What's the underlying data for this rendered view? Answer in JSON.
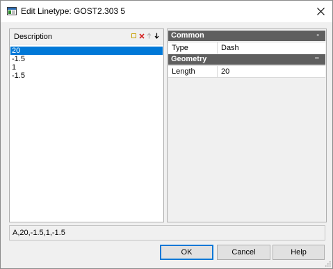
{
  "window": {
    "title": "Edit Linetype: GOST2.303 5"
  },
  "description_panel": {
    "header_label": "Description",
    "toolbar": [
      "add-icon",
      "delete-icon",
      "move-up-icon",
      "move-down-icon"
    ],
    "items": [
      "20",
      "-1.5",
      "1",
      "-1.5"
    ],
    "selected_index": 0
  },
  "properties": {
    "common": {
      "label": "Common",
      "toggle": "-",
      "type_name": "Type",
      "type_value": "Dash"
    },
    "geometry": {
      "label": "Geometry",
      "toggle": "−",
      "length_name": "Length",
      "length_value": "20"
    }
  },
  "status": {
    "definition": "A,20,-1.5,1,-1.5"
  },
  "buttons": {
    "ok": "OK",
    "cancel": "Cancel",
    "help": "Help"
  },
  "colors": {
    "selection": "#0078d7",
    "category_header": "#5f5f5f",
    "delete_icon": "#d42020",
    "add_icon": "#c8a000"
  }
}
